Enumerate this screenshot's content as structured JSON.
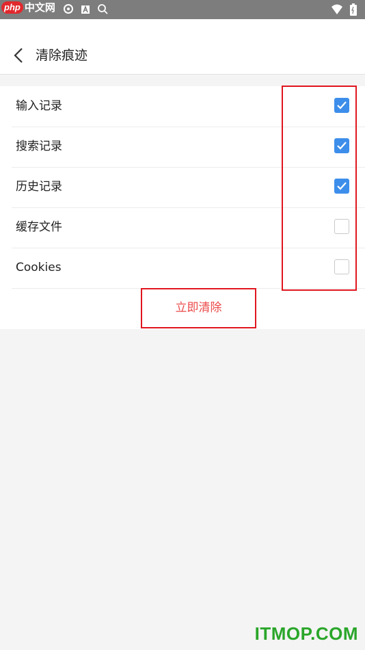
{
  "statusbar": {
    "logo_php": "php",
    "logo_site": "中文网"
  },
  "header": {
    "title": "清除痕迹"
  },
  "options": [
    {
      "label": "输入记录",
      "checked": true
    },
    {
      "label": "搜索记录",
      "checked": true
    },
    {
      "label": "历史记录",
      "checked": true
    },
    {
      "label": "缓存文件",
      "checked": false
    },
    {
      "label": "Cookies",
      "checked": false
    }
  ],
  "actions": {
    "clear_now_label": "立即清除"
  },
  "watermark": "ITMOP.COM",
  "colors": {
    "accent_checkbox": "#3d8eea",
    "danger_text": "#ec4a4a",
    "annotation_red": "#e0151e",
    "watermark_green": "#2aa62a"
  }
}
